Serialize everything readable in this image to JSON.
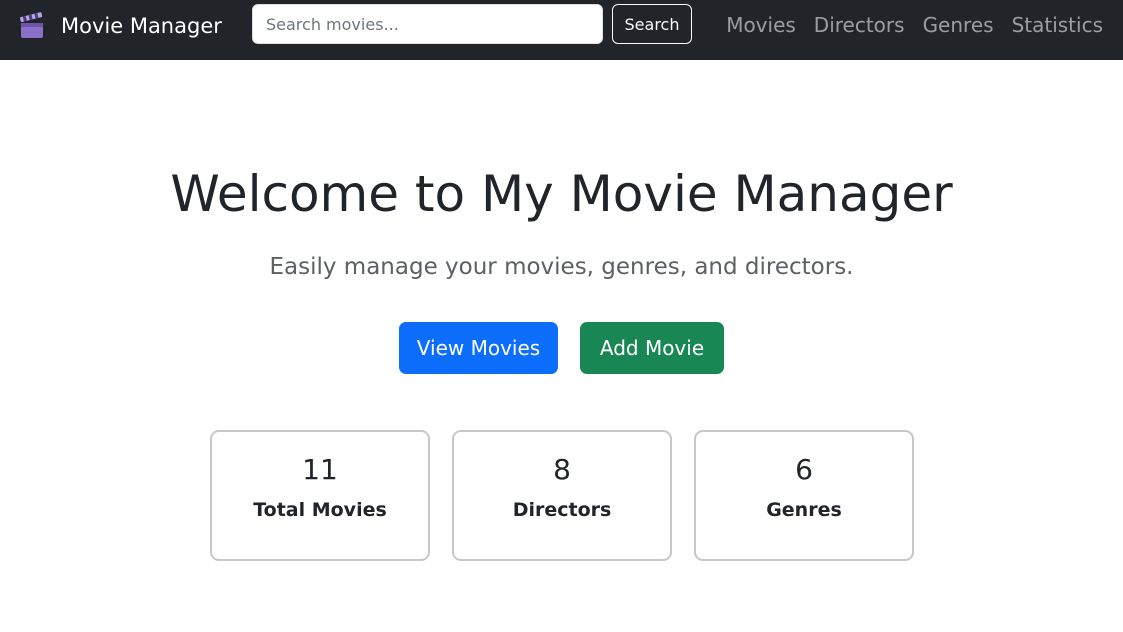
{
  "navbar": {
    "brand": "Movie Manager",
    "brand_icon": "clapperboard-icon",
    "search": {
      "placeholder": "Search movies...",
      "value": "",
      "button_label": "Search"
    },
    "links": [
      "Movies",
      "Directors",
      "Genres",
      "Statistics"
    ]
  },
  "hero": {
    "title": "Welcome to My Movie Manager",
    "subtitle": "Easily manage your movies, genres, and directors."
  },
  "actions": {
    "view_movies": "View Movies",
    "add_movie": "Add Movie"
  },
  "stats": [
    {
      "value": "11",
      "label": "Total Movies"
    },
    {
      "value": "8",
      "label": "Directors"
    },
    {
      "value": "6",
      "label": "Genres"
    }
  ],
  "colors": {
    "navbar_bg": "#212529",
    "primary": "#0d6efd",
    "success": "#198754",
    "card_border": "#c7c7c7"
  }
}
